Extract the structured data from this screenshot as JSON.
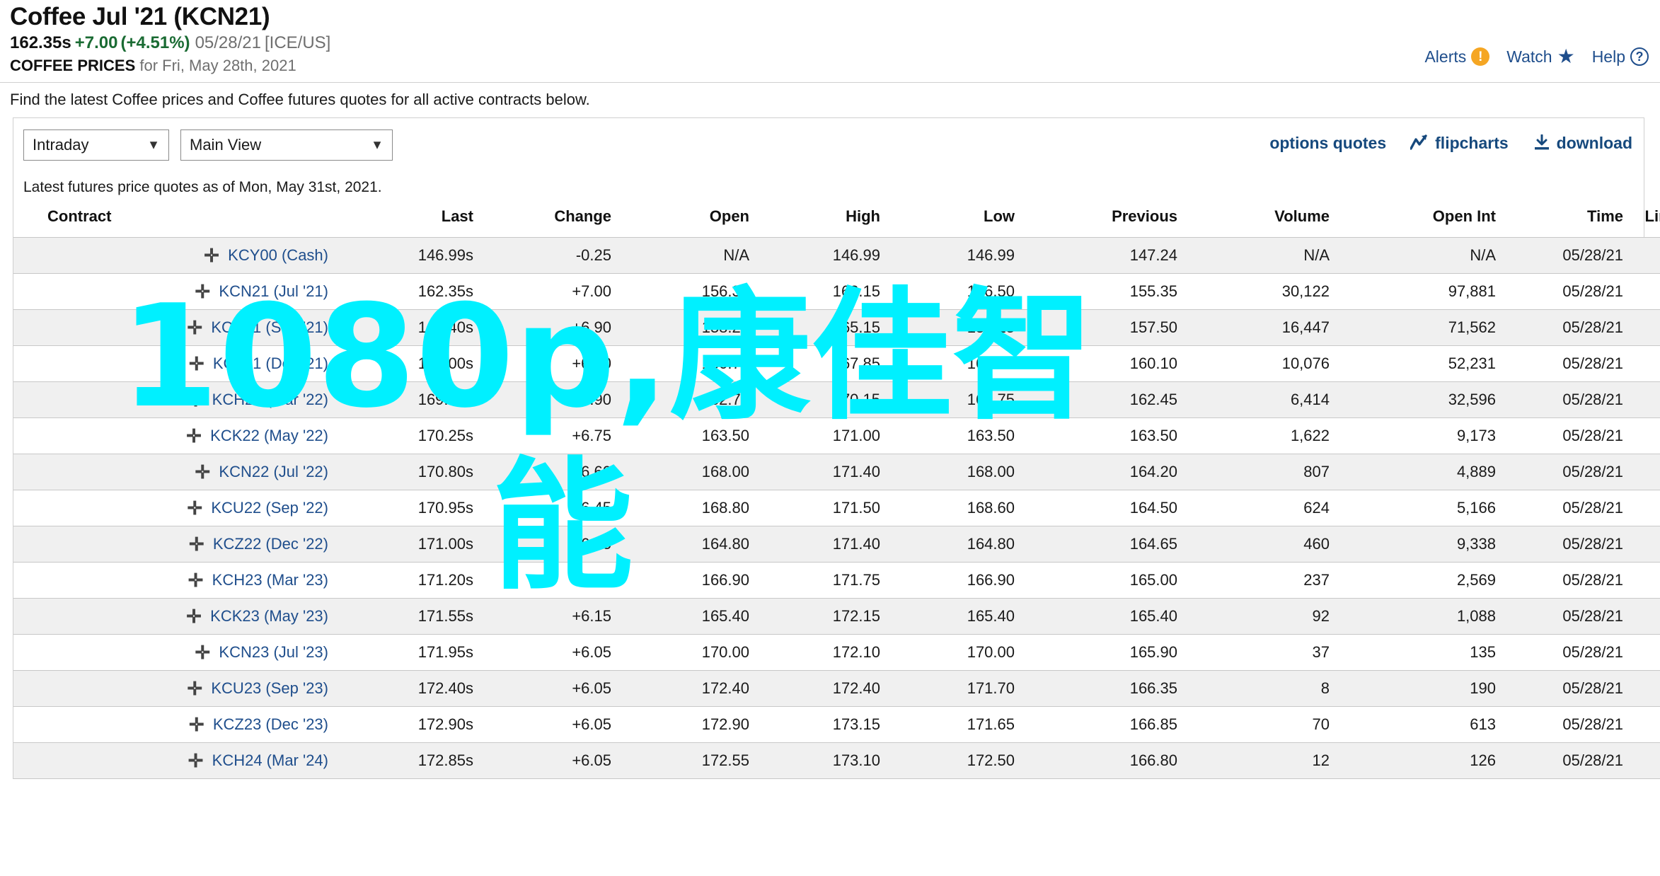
{
  "quote": {
    "title": "Coffee Jul '21 (KCN21)",
    "last": "162.35s",
    "change": "+7.00",
    "change_pct": "(+4.51%)",
    "date": "05/28/21",
    "exchange": "[ICE/US]",
    "change_color": "#1a6b33"
  },
  "subhead": {
    "label": "COFFEE PRICES",
    "rest": "for Fri, May 28th, 2021"
  },
  "util": {
    "alerts": "Alerts",
    "alerts_icon": "alert-exclamation-icon",
    "watch": "Watch",
    "watch_icon": "star-icon",
    "help": "Help",
    "help_icon": "question-circle-icon"
  },
  "intro": "Find the latest Coffee prices and Coffee futures quotes for all active contracts below.",
  "controls": {
    "view_period": "Intraday",
    "view_mode": "Main View",
    "caret_icon": "chevron-down-icon",
    "options_quotes": "options quotes",
    "flipcharts": "flipcharts",
    "flipcharts_icon": "chart-line-icon",
    "download": "download",
    "download_icon": "download-icon"
  },
  "as_of": "Latest futures price quotes as of Mon, May 31st, 2021.",
  "table": {
    "columns": [
      "Contract",
      "Last",
      "Change",
      "Open",
      "High",
      "Low",
      "Previous",
      "Volume",
      "Open Int",
      "Time",
      "Links"
    ],
    "row_icon": "expand-plus-icon",
    "links_icon": "kebab-menu-icon",
    "rows": [
      {
        "contract": "KCY00 (Cash)",
        "last": "146.99s",
        "change": "-0.25",
        "dir": "down",
        "open": "N/A",
        "high": "146.99",
        "low": "146.99",
        "previous": "147.24",
        "volume": "N/A",
        "open_int": "N/A",
        "time": "05/28/21"
      },
      {
        "contract": "KCN21 (Jul '21)",
        "last": "162.35s",
        "change": "+7.00",
        "dir": "up",
        "open": "156.35",
        "high": "163.15",
        "low": "156.50",
        "previous": "155.35",
        "volume": "30,122",
        "open_int": "97,881",
        "time": "05/28/21"
      },
      {
        "contract": "KCU21 (Sep '21)",
        "last": "164.40s",
        "change": "+6.90",
        "dir": "up",
        "open": "158.25",
        "high": "165.15",
        "low": "158.25",
        "previous": "157.50",
        "volume": "16,447",
        "open_int": "71,562",
        "time": "05/28/21"
      },
      {
        "contract": "KCZ21 (Dec '21)",
        "last": "167.00s",
        "change": "+6.90",
        "dir": "up",
        "open": "160.75",
        "high": "167.85",
        "low": "160.75",
        "previous": "160.10",
        "volume": "10,076",
        "open_int": "52,231",
        "time": "05/28/21"
      },
      {
        "contract": "KCH22 (Mar '22)",
        "last": "169.35s",
        "change": "+6.90",
        "dir": "up",
        "open": "162.75",
        "high": "170.15",
        "low": "162.75",
        "previous": "162.45",
        "volume": "6,414",
        "open_int": "32,596",
        "time": "05/28/21"
      },
      {
        "contract": "KCK22 (May '22)",
        "last": "170.25s",
        "change": "+6.75",
        "dir": "up",
        "open": "163.50",
        "high": "171.00",
        "low": "163.50",
        "previous": "163.50",
        "volume": "1,622",
        "open_int": "9,173",
        "time": "05/28/21"
      },
      {
        "contract": "KCN22 (Jul '22)",
        "last": "170.80s",
        "change": "+6.60",
        "dir": "up",
        "open": "168.00",
        "high": "171.40",
        "low": "168.00",
        "previous": "164.20",
        "volume": "807",
        "open_int": "4,889",
        "time": "05/28/21"
      },
      {
        "contract": "KCU22 (Sep '22)",
        "last": "170.95s",
        "change": "+6.45",
        "dir": "up",
        "open": "168.80",
        "high": "171.50",
        "low": "168.60",
        "previous": "164.50",
        "volume": "624",
        "open_int": "5,166",
        "time": "05/28/21"
      },
      {
        "contract": "KCZ22 (Dec '22)",
        "last": "171.00s",
        "change": "+6.35",
        "dir": "up",
        "open": "164.80",
        "high": "171.40",
        "low": "164.80",
        "previous": "164.65",
        "volume": "460",
        "open_int": "9,338",
        "time": "05/28/21"
      },
      {
        "contract": "KCH23 (Mar '23)",
        "last": "171.20s",
        "change": "+6.20",
        "dir": "up",
        "open": "166.90",
        "high": "171.75",
        "low": "166.90",
        "previous": "165.00",
        "volume": "237",
        "open_int": "2,569",
        "time": "05/28/21"
      },
      {
        "contract": "KCK23 (May '23)",
        "last": "171.55s",
        "change": "+6.15",
        "dir": "up",
        "open": "165.40",
        "high": "172.15",
        "low": "165.40",
        "previous": "165.40",
        "volume": "92",
        "open_int": "1,088",
        "time": "05/28/21"
      },
      {
        "contract": "KCN23 (Jul '23)",
        "last": "171.95s",
        "change": "+6.05",
        "dir": "up",
        "open": "170.00",
        "high": "172.10",
        "low": "170.00",
        "previous": "165.90",
        "volume": "37",
        "open_int": "135",
        "time": "05/28/21"
      },
      {
        "contract": "KCU23 (Sep '23)",
        "last": "172.40s",
        "change": "+6.05",
        "dir": "up",
        "open": "172.40",
        "high": "172.40",
        "low": "171.70",
        "previous": "166.35",
        "volume": "8",
        "open_int": "190",
        "time": "05/28/21"
      },
      {
        "contract": "KCZ23 (Dec '23)",
        "last": "172.90s",
        "change": "+6.05",
        "dir": "up",
        "open": "172.90",
        "high": "173.15",
        "low": "171.65",
        "previous": "166.85",
        "volume": "70",
        "open_int": "613",
        "time": "05/28/21"
      },
      {
        "contract": "KCH24 (Mar '24)",
        "last": "172.85s",
        "change": "+6.05",
        "dir": "up",
        "open": "172.55",
        "high": "173.10",
        "low": "172.50",
        "previous": "166.80",
        "volume": "12",
        "open_int": "126",
        "time": "05/28/21"
      }
    ]
  },
  "watermark": {
    "line1": "1080p,康佳智",
    "line2": "能",
    "color": "#00f0ff"
  }
}
